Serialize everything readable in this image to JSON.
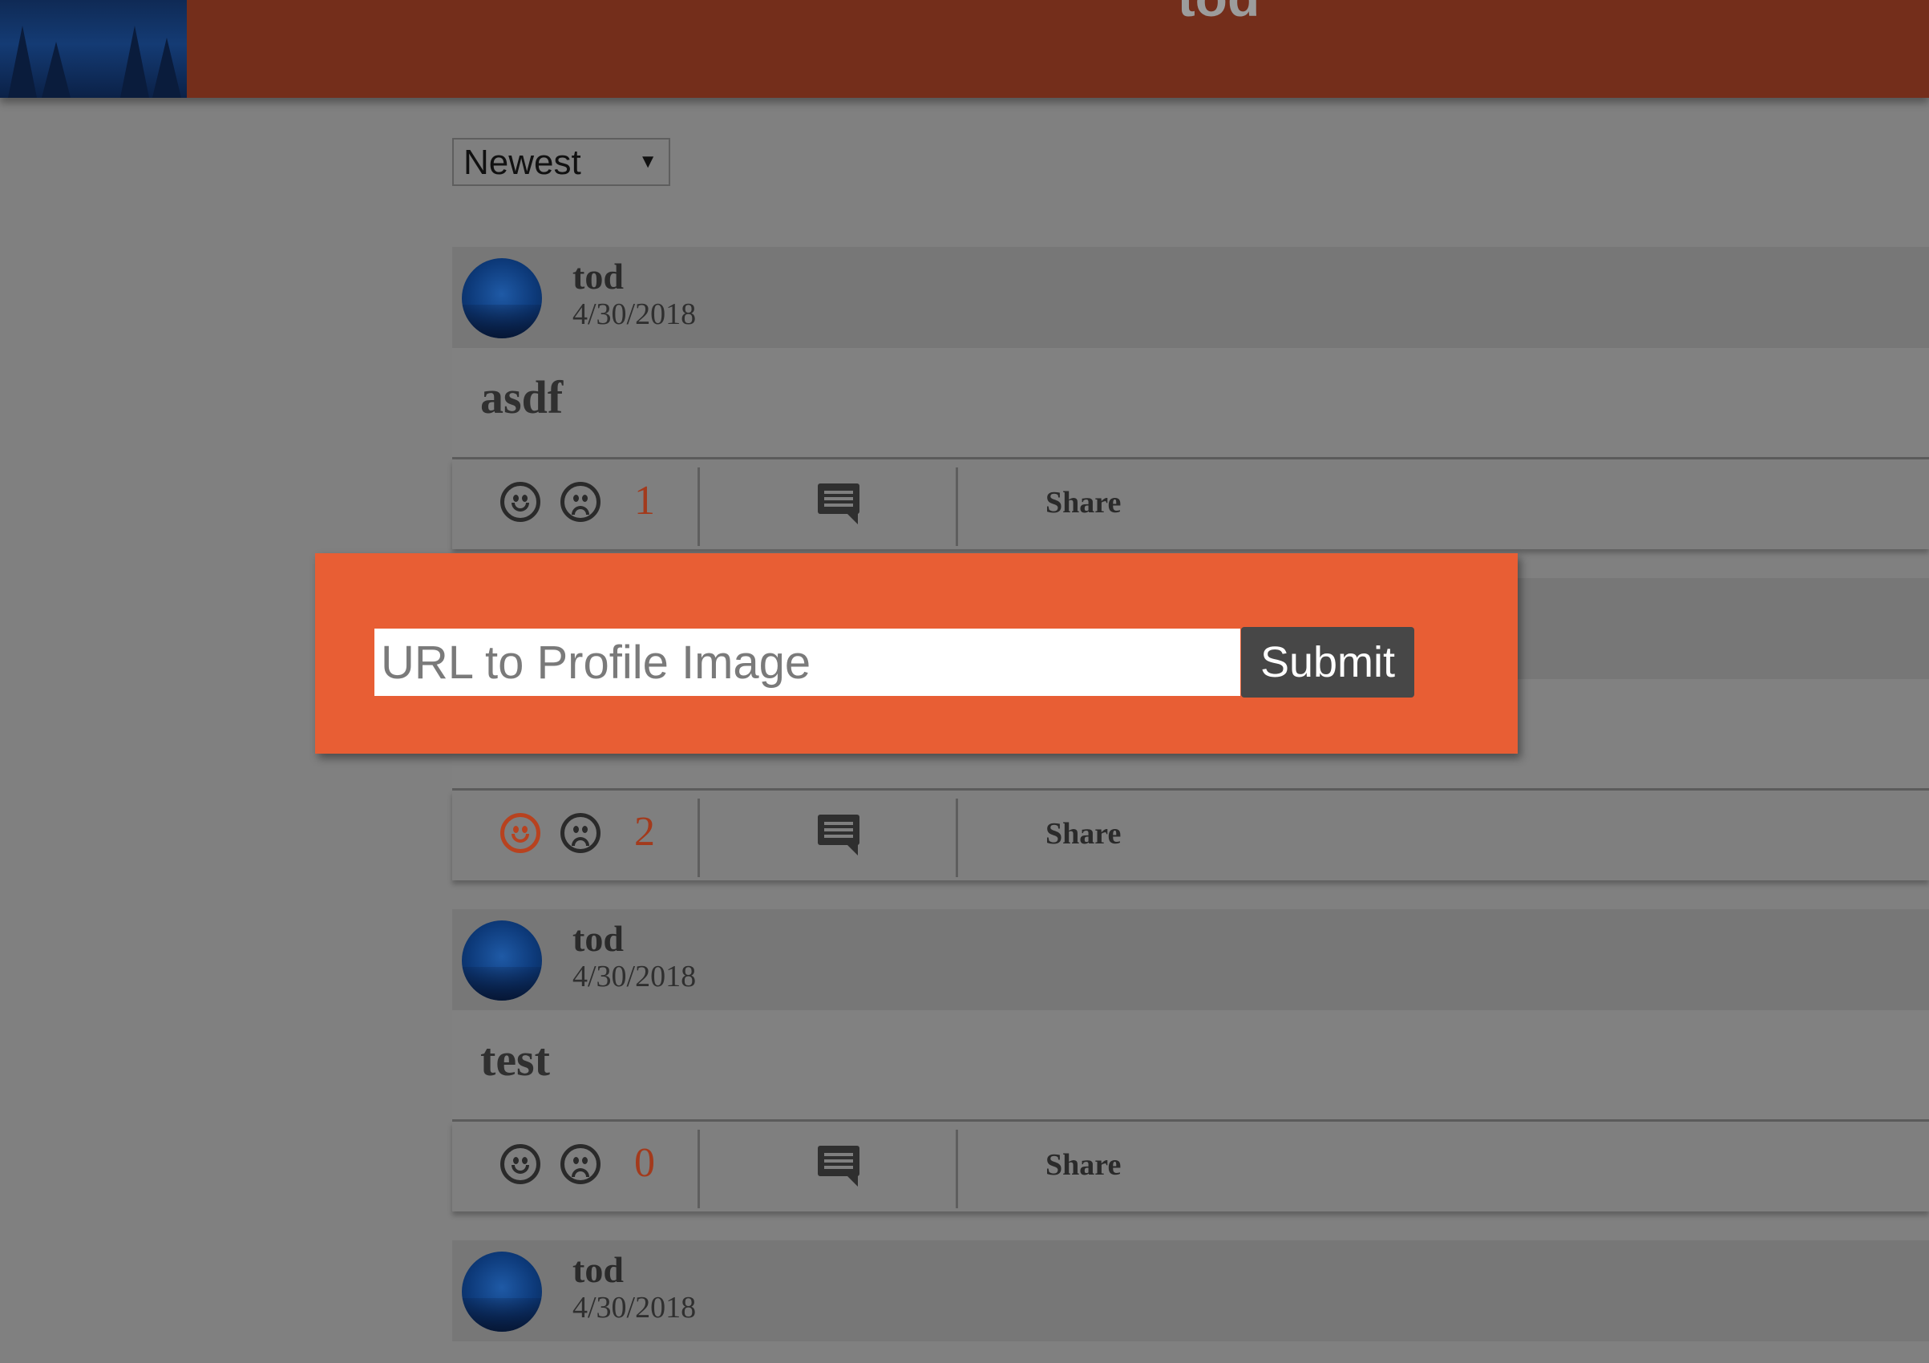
{
  "header": {
    "title": "tod"
  },
  "sort": {
    "selected": "Newest"
  },
  "modal": {
    "input_placeholder": "URL to Profile Image",
    "submit_label": "Submit"
  },
  "posts": [
    {
      "author": "tod",
      "date": "4/30/2018",
      "text": "asdf",
      "votes": "1",
      "share_label": "Share",
      "liked": false
    },
    {
      "author": "",
      "date": "",
      "text": "",
      "votes": "2",
      "share_label": "Share",
      "liked": true
    },
    {
      "author": "tod",
      "date": "4/30/2018",
      "text": "test",
      "votes": "0",
      "share_label": "Share",
      "liked": false
    },
    {
      "author": "tod",
      "date": "4/30/2018",
      "text": "",
      "votes": "",
      "share_label": "",
      "liked": false
    }
  ],
  "colors": {
    "header": "#742e1b",
    "modal": "#e85e34",
    "accent": "#a33a1c",
    "page": "#808080"
  }
}
